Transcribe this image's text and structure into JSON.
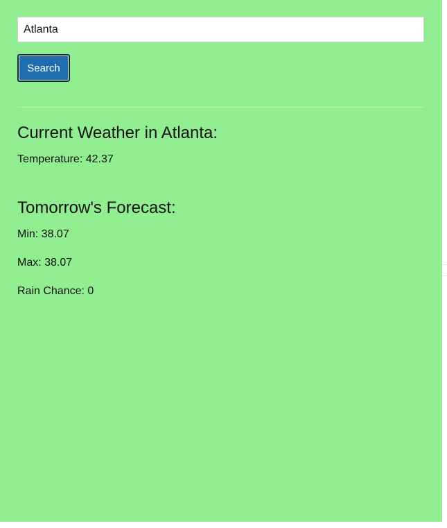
{
  "search": {
    "value": "Atlanta",
    "button_label": "Search"
  },
  "current": {
    "heading": "Current Weather in Atlanta:",
    "temperature_label": "Temperature: ",
    "temperature_value": "42.37"
  },
  "forecast": {
    "heading": "Tomorrow's Forecast:",
    "min_label": "Min: ",
    "min_value": "38.07",
    "max_label": "Max: ",
    "max_value": "38.07",
    "rain_label": "Rain Chance: ",
    "rain_value": "0"
  },
  "colors": {
    "background": "#90ee90",
    "button": "#1f6fb0"
  }
}
